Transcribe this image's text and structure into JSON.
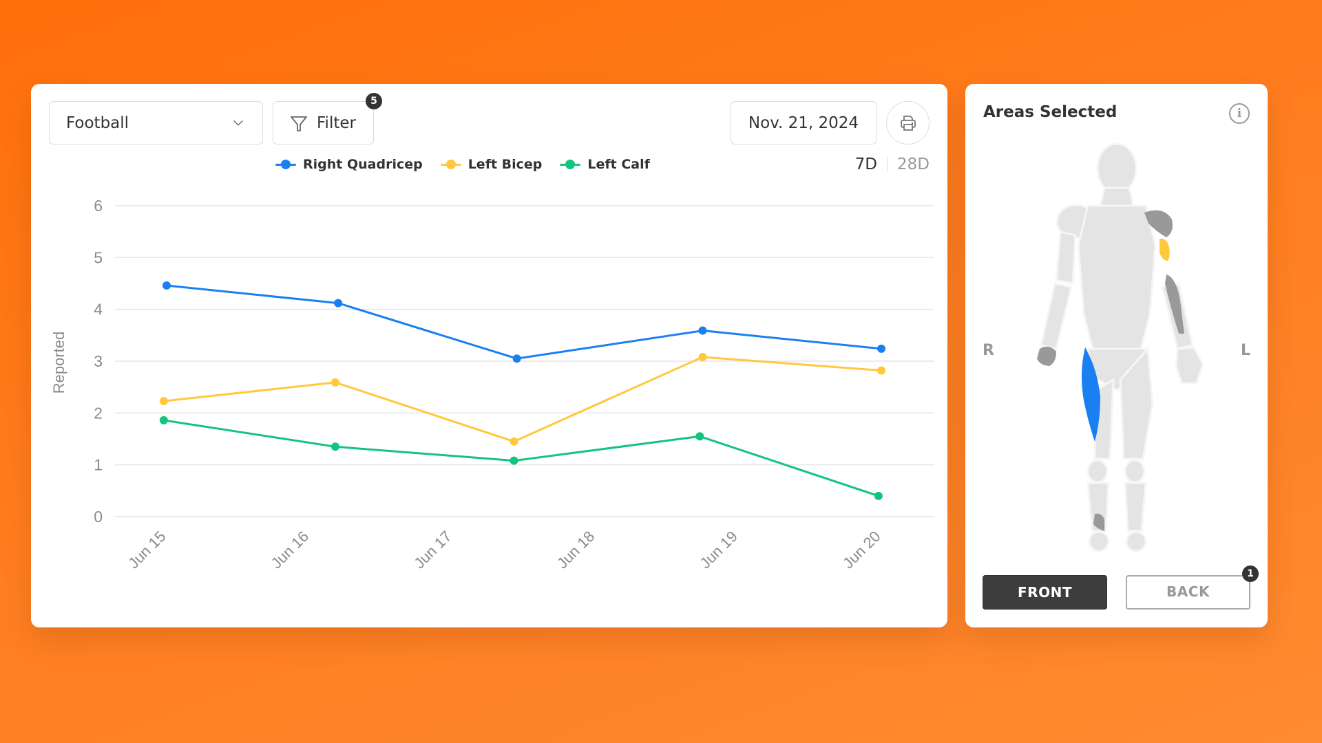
{
  "toolbar": {
    "sport_select": {
      "value": "Football",
      "icon": "chevron-down-icon"
    },
    "filter": {
      "label": "Filter",
      "icon": "funnel-icon",
      "badge_count": "5"
    },
    "date": "Nov. 21, 2024",
    "print": {
      "icon": "printer-icon"
    }
  },
  "range_toggle": {
    "options": [
      "7D",
      "28D"
    ],
    "selected": "7D"
  },
  "colors": {
    "right_quadricep": "#1a80f2",
    "left_bicep": "#ffc83d",
    "left_calf": "#13c47f",
    "grid": "#e6e6e6",
    "axis_text": "#8a8a8a"
  },
  "chart_data": {
    "type": "line",
    "title": "",
    "xlabel": "",
    "ylabel": "Reported",
    "x_tick_labels": [
      "Jun 15",
      "Jun 16",
      "Jun 17",
      "Jun 18",
      "Jun 19",
      "Jun 20"
    ],
    "x_tick_values": [
      15,
      16,
      17,
      18,
      19,
      20
    ],
    "y_ticks": [
      0,
      1,
      2,
      3,
      4,
      5,
      6
    ],
    "ylim": [
      0,
      6
    ],
    "xlim": [
      15,
      20
    ],
    "grid": true,
    "legend_position": "top",
    "series": [
      {
        "name": "Right Quadricep",
        "color_key": "right_quadricep",
        "x": [
          15.0,
          16.2,
          17.45,
          18.75,
          20.0
        ],
        "values": [
          4.46,
          4.12,
          3.05,
          3.59,
          3.24
        ]
      },
      {
        "name": "Left Bicep",
        "color_key": "left_bicep",
        "x": [
          14.98,
          16.18,
          17.43,
          18.75,
          20.0
        ],
        "values": [
          2.23,
          2.59,
          1.45,
          3.08,
          2.82
        ]
      },
      {
        "name": "Left Calf",
        "color_key": "left_calf",
        "x": [
          14.98,
          16.18,
          17.43,
          18.73,
          19.98
        ],
        "values": [
          1.86,
          1.35,
          1.08,
          1.55,
          0.4
        ]
      }
    ]
  },
  "areas_panel": {
    "title": "Areas Selected",
    "info_icon": "info-icon",
    "right_label": "R",
    "left_label": "L",
    "highlighted": [
      {
        "area": "Right Quadricep",
        "color_key": "right_quadricep"
      },
      {
        "area": "Left Bicep",
        "color_key": "left_bicep"
      }
    ],
    "front_label": "FRONT",
    "back_label": "BACK",
    "back_badge_count": "1",
    "selected_view": "FRONT"
  }
}
